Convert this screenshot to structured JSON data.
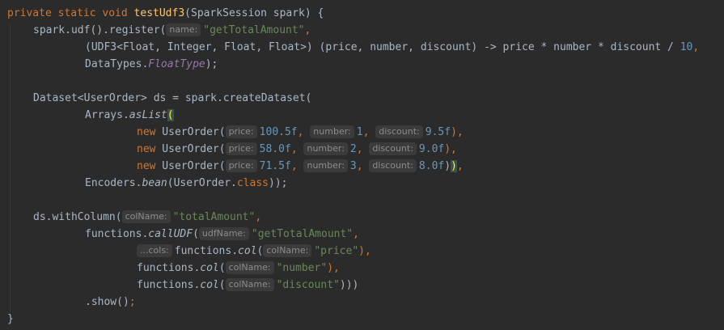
{
  "code": {
    "l1": {
      "kw": "private static void ",
      "method": "testUdf3",
      "rest": "(SparkSession spark) {"
    },
    "l2": {
      "a": "spark.udf().register(",
      "hint": "name:",
      "str": "\"getTotalAmount\"",
      "end": ","
    },
    "l3": {
      "a": "(UDF3<Float, Integer, Float, Float>) (price, number, discount) -> price * number * discount / ",
      "num": "10",
      "end": ","
    },
    "l4": {
      "a": "DataTypes.",
      "field": "FloatType",
      "end": ");"
    },
    "l6": {
      "a": "Dataset<UserOrder> ds = spark.createDataset("
    },
    "l7": {
      "a": "Arrays.",
      "m": "asList",
      "p": "("
    },
    "rows": [
      {
        "new": "new",
        "cls": " UserOrder(",
        "h1": "price:",
        "v1": "100.5f",
        "h2": "number:",
        "v2": "1",
        "h3": "discount:",
        "v3": "9.5f",
        "end": "),"
      },
      {
        "new": "new",
        "cls": " UserOrder(",
        "h1": "price:",
        "v1": "58.0f",
        "h2": "number:",
        "v2": "2",
        "h3": "discount:",
        "v3": "9.0f",
        "end": "),"
      },
      {
        "new": "new",
        "cls": " UserOrder(",
        "h1": "price:",
        "v1": "71.5f",
        "h2": "number:",
        "v2": "3",
        "h3": "discount:",
        "v3": "8.0f",
        "end1": ")",
        "end2": ")",
        "end3": ","
      }
    ],
    "l11": {
      "a": "Encoders.",
      "m": "bean",
      "b": "(UserOrder.",
      "kw": "class",
      "end": "));"
    },
    "l13": {
      "a": "ds.withColumn(",
      "hint": "colName:",
      "str": "\"totalAmount\"",
      "end": ","
    },
    "l14": {
      "a": "functions.",
      "m": "callUDF",
      "p": "(",
      "hint": "udfName:",
      "str": "\"getTotalAmount\"",
      "end": ","
    },
    "l15": {
      "hint": "...cols:",
      "a": "functions.",
      "m": "col",
      "p": "(",
      "hint2": "colName:",
      "str": "\"price\"",
      "end": "),"
    },
    "l16": {
      "a": "functions.",
      "m": "col",
      "p": "(",
      "hint": "colName:",
      "str": "\"number\"",
      "end": "),"
    },
    "l17": {
      "a": "functions.",
      "m": "col",
      "p": "(",
      "hint": "colName:",
      "str": "\"discount\"",
      "end": ")))"
    },
    "l18": {
      "a": ".show()",
      "end": ";"
    },
    "l19": {
      "a": "}"
    }
  }
}
